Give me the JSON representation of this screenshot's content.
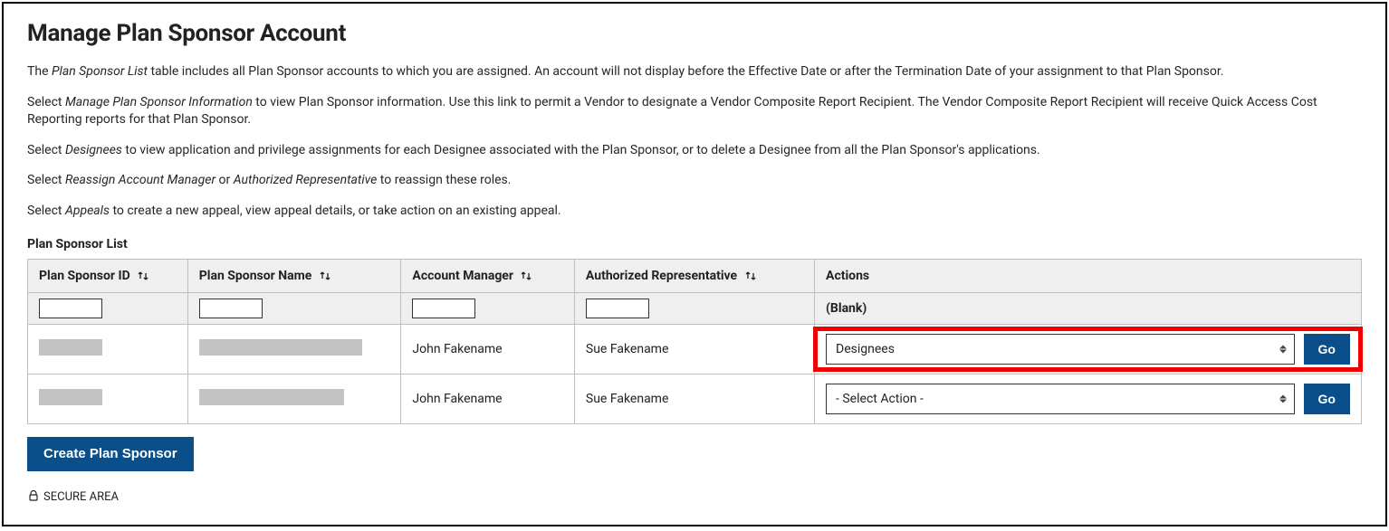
{
  "page_title": "Manage Plan Sponsor Account",
  "intro1_pre": "The ",
  "intro1_em": "Plan Sponsor List",
  "intro1_post": " table includes all Plan Sponsor accounts to which you are assigned. An account will not display before the Effective Date or after the Termination Date of your assignment to that Plan Sponsor.",
  "intro2_pre": "Select ",
  "intro2_em": "Manage Plan Sponsor Information",
  "intro2_post": " to view Plan Sponsor information. Use this link to permit a Vendor to designate a Vendor Composite Report Recipient. The Vendor Composite Report Recipient will receive Quick Access Cost Reporting reports for that Plan Sponsor.",
  "intro3_pre": "Select ",
  "intro3_em": "Designees",
  "intro3_post": " to view application and privilege assignments for each Designee associated with the Plan Sponsor, or to delete a Designee from all the Plan Sponsor's applications.",
  "intro4_pre": "Select ",
  "intro4_em1": "Reassign Account Manager",
  "intro4_mid": " or ",
  "intro4_em2": "Authorized Representative",
  "intro4_post": " to reassign these roles.",
  "intro5_pre": "Select ",
  "intro5_em": "Appeals",
  "intro5_post": " to create a new appeal, view appeal details, or take action on an existing appeal.",
  "table_title": "Plan Sponsor List",
  "columns": {
    "id": "Plan Sponsor ID",
    "name": "Plan Sponsor Name",
    "mgr": "Account Manager",
    "rep": "Authorized Representative",
    "actions": "Actions"
  },
  "blank_label": "(Blank)",
  "rows": [
    {
      "mgr": "John Fakename",
      "rep": "Sue Fakename",
      "action_selected": "Designees",
      "go": "Go",
      "highlight": true
    },
    {
      "mgr": "John Fakename",
      "rep": "Sue Fakename",
      "action_selected": "- Select Action -",
      "go": "Go",
      "highlight": false
    }
  ],
  "create_btn": "Create Plan Sponsor",
  "secure_area": "SECURE AREA"
}
